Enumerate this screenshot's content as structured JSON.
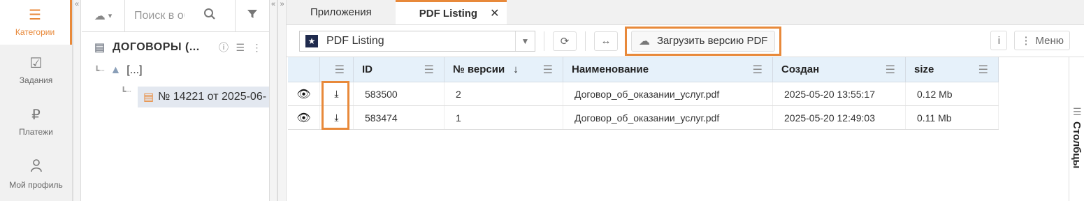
{
  "nav": {
    "items": [
      {
        "label": "Категории",
        "icon": "menu-icon",
        "glyph": "☰",
        "active": true
      },
      {
        "label": "Задания",
        "icon": "task-check-icon",
        "glyph": "☑"
      },
      {
        "label": "Платежи",
        "icon": "ruble-icon",
        "glyph": "₽"
      },
      {
        "label": "Мой профиль",
        "icon": "user-icon",
        "glyph": "👤"
      }
    ]
  },
  "splitters": {
    "left_collapse": "«",
    "right_collapse": "«",
    "right_expand": "»"
  },
  "tree": {
    "search_placeholder": "Поиск в облаке",
    "root_title": "ДОГОВОРЫ (...",
    "up_label": "[...]",
    "selected_item": "№ 14221 от 2025-06-"
  },
  "tabs": [
    {
      "label": "Приложения"
    },
    {
      "label": "PDF Listing",
      "active": true,
      "close": "✕"
    }
  ],
  "toolbar": {
    "select_value": "PDF Listing",
    "upload_label": "Загрузить версию PDF",
    "info_label": "i",
    "menu_label": "Меню"
  },
  "grid": {
    "columns": [
      "ID",
      "№ версии",
      "Наименование",
      "Создан",
      "size"
    ],
    "rows": [
      {
        "id": "583500",
        "version": "2",
        "name": "Договор_об_оказании_услуг.pdf",
        "created": "2025-05-20 13:55:17",
        "size": "0.12 Mb"
      },
      {
        "id": "583474",
        "version": "1",
        "name": "Договор_об_оказании_услуг.pdf",
        "created": "2025-05-20 12:49:03",
        "size": "0.11 Mb"
      }
    ]
  },
  "columns_panel": {
    "label": "Столбцы"
  },
  "colors": {
    "accent": "#e8893a",
    "header_bg": "#e6f1fa",
    "star_bg": "#1f2a4d"
  }
}
